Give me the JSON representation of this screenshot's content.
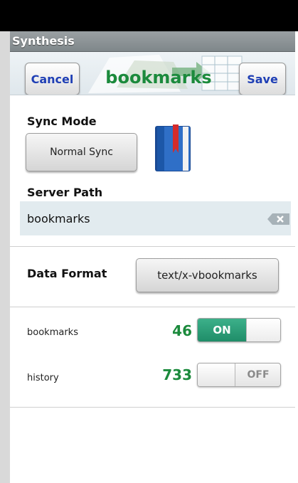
{
  "app": {
    "title": "Synthesis"
  },
  "header": {
    "cancel_label": "Cancel",
    "title": "bookmarks",
    "save_label": "Save"
  },
  "sync_mode": {
    "label": "Sync Mode",
    "value": "Normal Sync"
  },
  "server_path": {
    "label": "Server Path",
    "value": "bookmarks"
  },
  "data_format": {
    "label": "Data Format",
    "value": "text/x-vbookmarks"
  },
  "sync_items": [
    {
      "name": "bookmarks",
      "count": "46",
      "toggle_label": "ON",
      "enabled": true
    },
    {
      "name": "history",
      "count": "733",
      "toggle_label": "OFF",
      "enabled": false
    }
  ],
  "colors": {
    "accent_green": "#1b8a3c",
    "button_text_blue": "#1f3fb5",
    "toggle_on": "#2a9e78"
  },
  "icons": {
    "sync_type_icon": "bookmark-book-icon",
    "clear_icon": "clear-text-icon"
  }
}
